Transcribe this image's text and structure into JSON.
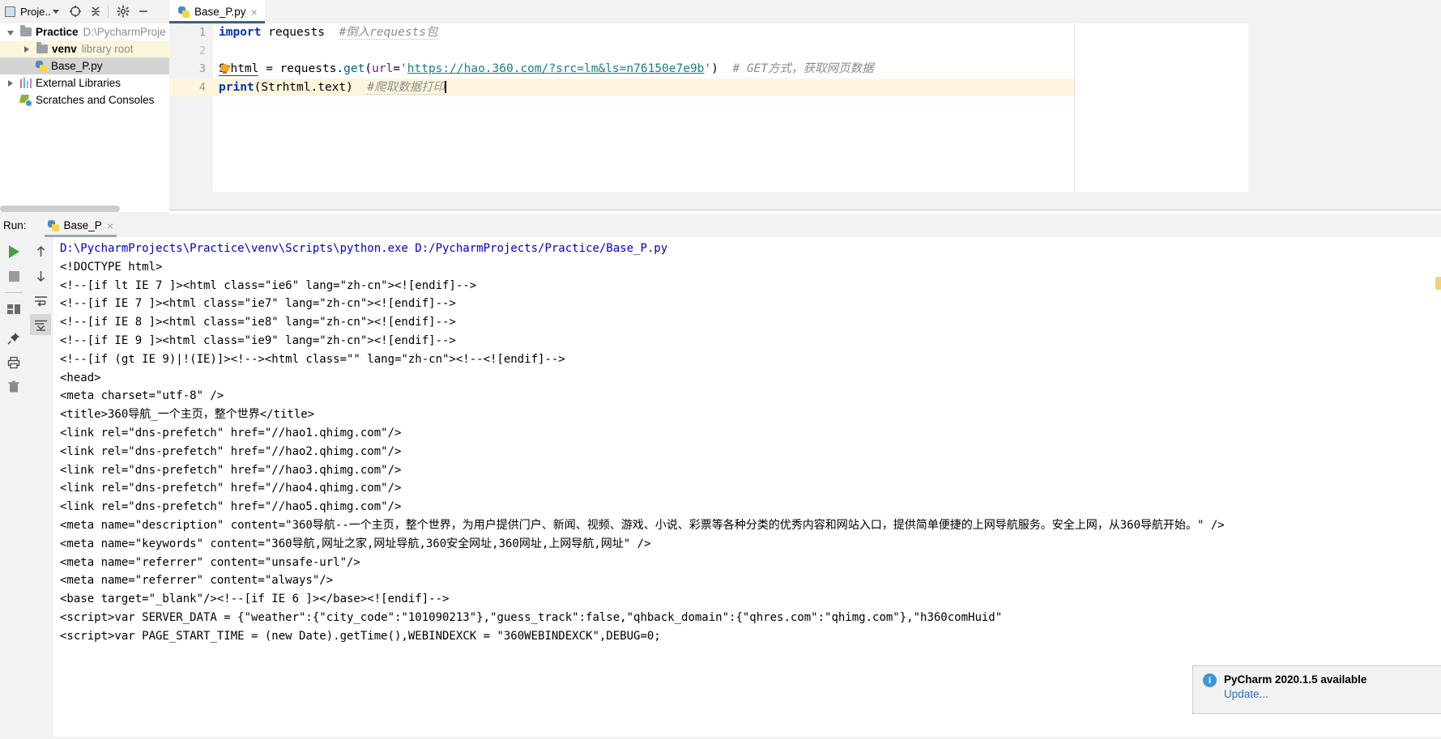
{
  "project_tool": {
    "title": "Proje..",
    "icons": [
      "project-window-icon",
      "locate-icon",
      "collapse-all-icon",
      "settings-icon",
      "hide-icon"
    ],
    "tree": [
      {
        "label": "Practice",
        "sub": "D:\\PycharmProje",
        "icon": "folder-icon",
        "expanded": true,
        "indent": 0,
        "bold": true,
        "highlight": "none"
      },
      {
        "label": "venv",
        "sub": "library root",
        "icon": "folder-icon",
        "expanded": false,
        "indent": 1,
        "bold": true,
        "highlight": "yellow"
      },
      {
        "label": "Base_P.py",
        "sub": "",
        "icon": "python-file-icon",
        "expanded": null,
        "indent": 2,
        "bold": false,
        "highlight": "grey"
      },
      {
        "label": "External Libraries",
        "sub": "",
        "icon": "library-icon",
        "expanded": false,
        "indent": 0,
        "bold": false,
        "highlight": "none"
      },
      {
        "label": "Scratches and Consoles",
        "sub": "",
        "icon": "scratches-icon",
        "expanded": null,
        "indent": 0,
        "bold": false,
        "highlight": "none"
      }
    ]
  },
  "editor": {
    "tab": {
      "label": "Base_P.py",
      "icon": "python-file-icon",
      "close": "×"
    },
    "line_numbers": [
      "1",
      "2",
      "3",
      "4"
    ],
    "current_line": 4,
    "code": {
      "line1_kw": "import",
      "line1_mod": " requests",
      "line1_comment": "#倒入requests包",
      "line3_var_a": "S",
      "line3_var_b": "rhtml",
      "line3_assign": " = requests.",
      "line3_call": "get",
      "line3_paren_open": "(",
      "line3_param": "url",
      "line3_eq": "=",
      "line3_quote": "'",
      "line3_url": "https://hao.360.com/?src=lm&ls=n76150e7e9b",
      "line3_quote2": "'",
      "line3_paren_close": ")",
      "line3_comment": "# GET方式，获取网页数据",
      "line4_fn": "print",
      "line4_args": "(Strhtml.text)",
      "line4_comment": "#爬取数据打印"
    }
  },
  "run_panel": {
    "label": "Run:",
    "tab": {
      "label": "Base_P",
      "icon": "python-file-icon",
      "close": "×"
    },
    "toolbar_left": [
      "run-icon",
      "stop-icon",
      "layout-icon",
      "pin-icon",
      "print-icon",
      "trash-icon"
    ],
    "toolbar_right": [
      "scroll-up-icon",
      "scroll-down-icon",
      "soft-wrap-icon",
      "scroll-to-end-icon"
    ],
    "console_lines": [
      "D:\\PycharmProjects\\Practice\\venv\\Scripts\\python.exe D:/PycharmProjects/Practice/Base_P.py",
      "<!DOCTYPE html>",
      "<!--[if lt IE 7 ]><html class=\"ie6\" lang=\"zh-cn\"><![endif]-->",
      "<!--[if IE 7 ]><html class=\"ie7\" lang=\"zh-cn\"><![endif]-->",
      "<!--[if IE 8 ]><html class=\"ie8\" lang=\"zh-cn\"><![endif]-->",
      "<!--[if IE 9 ]><html class=\"ie9\" lang=\"zh-cn\"><![endif]-->",
      "<!--[if (gt IE 9)|!(IE)]><!--><html class=\"\" lang=\"zh-cn\"><!--<![endif]-->",
      "<head>",
      "<meta charset=\"utf-8\" />",
      "<title>360导航_一个主页，整个世界</title>",
      "<link rel=\"dns-prefetch\" href=\"//hao1.qhimg.com\"/>",
      "<link rel=\"dns-prefetch\" href=\"//hao2.qhimg.com\"/>",
      "<link rel=\"dns-prefetch\" href=\"//hao3.qhimg.com\"/>",
      "<link rel=\"dns-prefetch\" href=\"//hao4.qhimg.com\"/>",
      "<link rel=\"dns-prefetch\" href=\"//hao5.qhimg.com\"/>",
      "<meta name=\"description\" content=\"360导航--一个主页，整个世界，为用户提供门户、新闻、视频、游戏、小说、彩票等各种分类的优秀内容和网站入口，提供简单便捷的上网导航服务。安全上网，从360导航开始。\" />",
      "<meta name=\"keywords\" content=\"360导航,网址之家,网址导航,360安全网址,360网址,上网导航,网址\" />",
      "<meta name=\"referrer\" content=\"unsafe-url\"/>",
      "<meta name=\"referrer\" content=\"always\"/>",
      "<base target=\"_blank\"/><!--[if IE 6 ]></base><![endif]-->",
      "<script>var SERVER_DATA = {\"weather\":{\"city_code\":\"101090213\"},\"guess_track\":false,\"qhback_domain\":{\"qhres.com\":\"qhimg.com\"},\"h360comHuid\"",
      "<script>var PAGE_START_TIME = (new Date).getTime(),WEBINDEXCK = \"360WEBINDEXCK\",DEBUG=0;"
    ]
  },
  "notification": {
    "icon": "info-icon",
    "title": "PyCharm 2020.1.5 available",
    "link": "Update..."
  },
  "colors": {
    "keyword": "#0033b3",
    "string": "#067d17",
    "comment": "#8c8c8c",
    "url": "#1a7f7f",
    "param": "#871094",
    "console_cmd": "#0000c0",
    "tab_underline": "#3d6185",
    "notif_link": "#2f6fb5"
  }
}
